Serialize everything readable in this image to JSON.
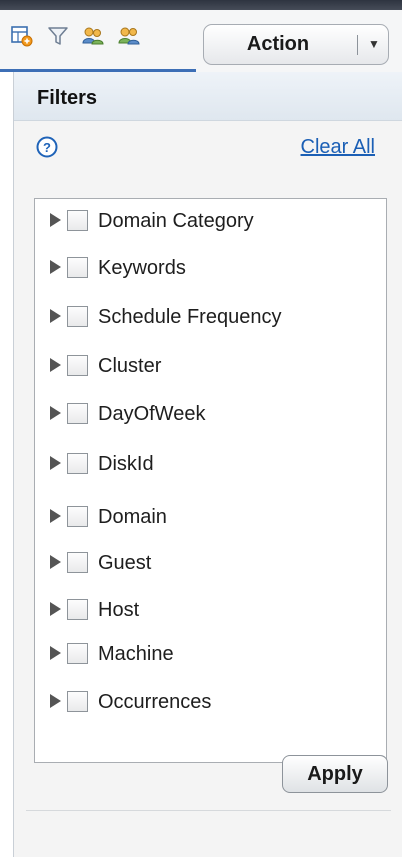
{
  "toolbar": {
    "icons": [
      "column-chooser-icon",
      "filter-icon",
      "users-icon",
      "user-group-icon"
    ],
    "action_label": "Action",
    "action_caret": "▼"
  },
  "panel": {
    "title": "Filters",
    "help_symbol": "?",
    "clear_all": "Clear All",
    "apply_label": "Apply"
  },
  "filters": [
    {
      "label": "Domain Category"
    },
    {
      "label": "Keywords"
    },
    {
      "label": "Schedule Frequency"
    },
    {
      "label": "Cluster"
    },
    {
      "label": "DayOfWeek"
    },
    {
      "label": "DiskId"
    },
    {
      "label": "Domain"
    },
    {
      "label": "Guest"
    },
    {
      "label": "Host"
    },
    {
      "label": "Machine"
    },
    {
      "label": "Occurrences"
    }
  ],
  "colors": {
    "accent": "#3d6fb6",
    "link": "#1b5fb5"
  }
}
